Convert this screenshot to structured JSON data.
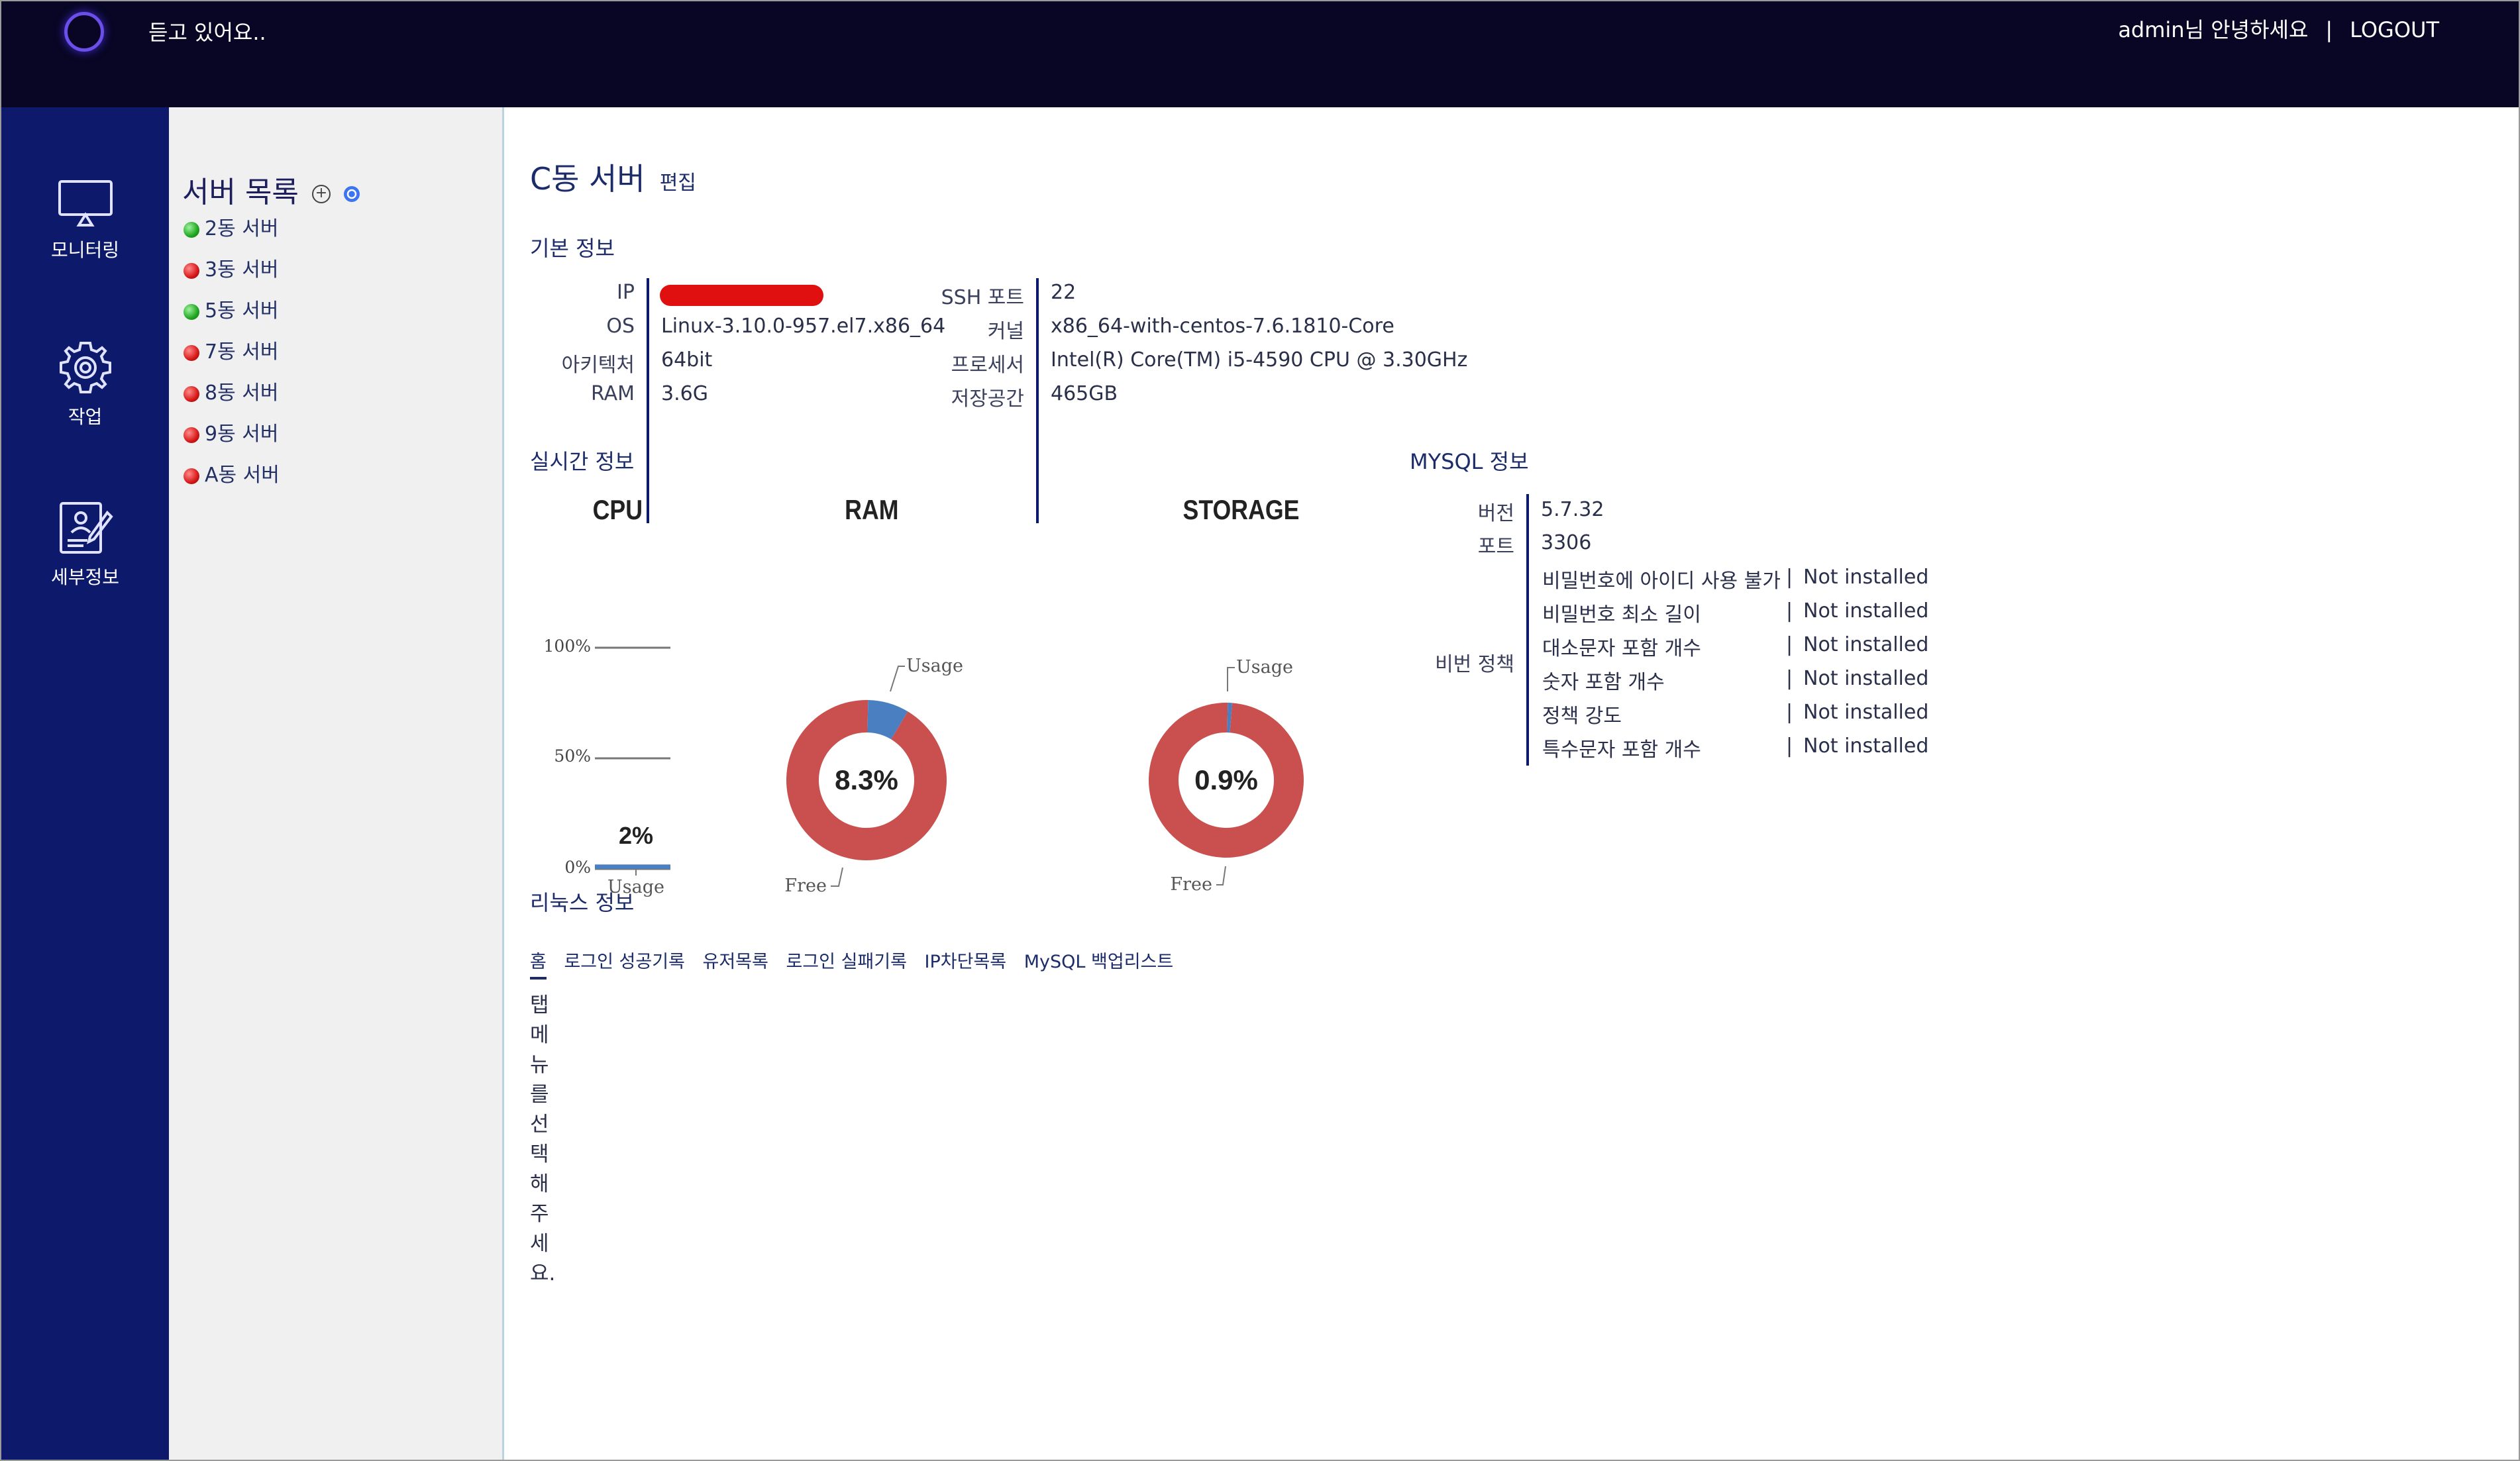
{
  "topbar": {
    "listen_text": "듣고 있어요..",
    "greeting": "admin님 안녕하세요",
    "separator": "|",
    "logout_label": "LOGOUT"
  },
  "nav": [
    {
      "label": "모니터링",
      "icon": "monitor-icon"
    },
    {
      "label": "작업",
      "icon": "gear-icon"
    },
    {
      "label": "세부정보",
      "icon": "detail-doc-icon"
    }
  ],
  "server_list": {
    "title": "서버 목록",
    "add_icon": "+",
    "items": [
      {
        "label": "2동 서버",
        "status": "green"
      },
      {
        "label": "3동 서버",
        "status": "red"
      },
      {
        "label": "5동 서버",
        "status": "green"
      },
      {
        "label": "7동 서버",
        "status": "red"
      },
      {
        "label": "8동 서버",
        "status": "red"
      },
      {
        "label": "9동 서버",
        "status": "red"
      },
      {
        "label": "A동 서버",
        "status": "red"
      }
    ]
  },
  "page": {
    "title": "C동 서버",
    "edit_label": "편집"
  },
  "basic_info": {
    "title": "기본 정보",
    "left": [
      {
        "key": "IP",
        "value": ""
      },
      {
        "key": "OS",
        "value": "Linux-3.10.0-957.el7.x86_64"
      },
      {
        "key": "아키텍처",
        "value": "64bit"
      },
      {
        "key": "RAM",
        "value": "3.6G"
      }
    ],
    "right": [
      {
        "key": "SSH 포트",
        "value": "22"
      },
      {
        "key": "커널",
        "value": "x86_64-with-centos-7.6.1810-Core"
      },
      {
        "key": "프로세서",
        "value": "Intel(R) Core(TM) i5-4590 CPU @ 3.30GHz"
      },
      {
        "key": "저장공간",
        "value": "465GB"
      }
    ]
  },
  "realtime": {
    "title": "실시간 정보",
    "cpu": {
      "title": "CPU",
      "ticks": [
        "100%",
        "50%",
        "0%"
      ],
      "value_label": "2%",
      "usage_label": "Usage"
    },
    "ram": {
      "title": "RAM",
      "value_label": "8.3%",
      "usage_label": "Usage",
      "free_label": "Free"
    },
    "storage": {
      "title": "STORAGE",
      "value_label": "0.9%",
      "usage_label": "Usage",
      "free_label": "Free"
    }
  },
  "chart_data": [
    {
      "type": "bar",
      "title": "CPU",
      "categories": [
        "Usage"
      ],
      "values": [
        2
      ],
      "ylim": [
        0,
        100
      ],
      "yticks": [
        "0%",
        "50%",
        "100%"
      ]
    },
    {
      "type": "pie",
      "title": "RAM",
      "categories": [
        "Usage",
        "Free"
      ],
      "values": [
        8.3,
        91.7
      ],
      "colors": [
        "#4a7fc1",
        "#c9504f"
      ]
    },
    {
      "type": "pie",
      "title": "STORAGE",
      "categories": [
        "Usage",
        "Free"
      ],
      "values": [
        0.9,
        99.1
      ],
      "colors": [
        "#4a7fc1",
        "#c9504f"
      ]
    }
  ],
  "mysql": {
    "title": "MYSQL 정보",
    "version_key": "버전",
    "version": "5.7.32",
    "port_key": "포트",
    "port": "3306",
    "policy_key": "비번 정책",
    "policies": [
      {
        "name": "비밀번호에 아이디 사용 불가",
        "sep": "|",
        "value": "Not installed"
      },
      {
        "name": "비밀번호 최소 길이",
        "sep": "|",
        "value": "Not installed"
      },
      {
        "name": "대소문자 포함 개수",
        "sep": "|",
        "value": "Not installed"
      },
      {
        "name": "숫자 포함 개수",
        "sep": "|",
        "value": "Not installed"
      },
      {
        "name": "정책 강도",
        "sep": "|",
        "value": "Not installed"
      },
      {
        "name": "특수문자 포함 개수",
        "sep": "|",
        "value": "Not installed"
      }
    ]
  },
  "linux": {
    "title": "리눅스 정보",
    "tabs": [
      "홈",
      "로그인 성공기록",
      "유저목록",
      "로그인 실패기록",
      "IP차단목록",
      "MySQL 백업리스트"
    ],
    "hint": "탭 메뉴를 선택해주세요."
  },
  "colors": {
    "topbar": "#080624",
    "nav": "#0d1a6b",
    "usage": "#4a7fc1",
    "free": "#c9504f"
  }
}
